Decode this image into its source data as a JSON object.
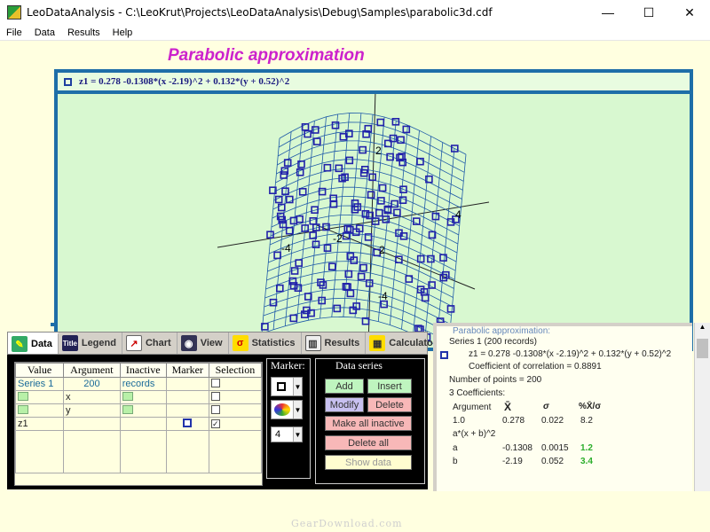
{
  "window": {
    "title": "LeoDataAnalysis - C:\\LeoKrut\\Projects\\LeoDataAnalysis\\Debug\\Samples\\parabolic3d.cdf",
    "minimize": "—",
    "maximize": "☐",
    "close": "✕"
  },
  "menu": [
    "File",
    "Data",
    "Results",
    "Help"
  ],
  "heading": "Parabolic approximation",
  "formula": "z1 = 0.278 -0.1308*(x -2.19)^2 + 0.132*(y + 0.52)^2",
  "plot_labels": {
    "neg4": "-4",
    "two_top": "2",
    "four_right": "4",
    "neg2": "-2",
    "two_mid": "2",
    "neg4_low": "-4",
    "six_low": "-6"
  },
  "tabs": [
    {
      "label": "Data",
      "icon": "pencil-icon"
    },
    {
      "label": "Legend",
      "icon": "title-icon"
    },
    {
      "label": "Chart",
      "icon": "chart-icon"
    },
    {
      "label": "View",
      "icon": "eye-icon"
    },
    {
      "label": "Statistics",
      "icon": "sigma-icon"
    },
    {
      "label": "Results",
      "icon": "book-icon"
    },
    {
      "label": "Calculator",
      "icon": "calculator-icon"
    }
  ],
  "grid": {
    "headers": [
      "Value",
      "Argument",
      "Inactive",
      "Marker",
      "Selection"
    ],
    "rows": [
      {
        "value": "Series 1",
        "argument": "200",
        "inactive": "records"
      },
      {
        "value": "",
        "argument": "x",
        "inactive": ""
      },
      {
        "value": "",
        "argument": "y",
        "inactive": ""
      },
      {
        "value": "z1",
        "argument": "",
        "inactive": ""
      }
    ]
  },
  "marker": {
    "label": "Marker:",
    "size": "4"
  },
  "series": {
    "label": "Data series",
    "add": "Add",
    "insert": "Insert",
    "modify": "Modify",
    "delete": "Delete",
    "make_inactive": "Make all inactive",
    "delete_all": "Delete all",
    "show_data": "Show data"
  },
  "results": {
    "title": "Parabolic approximation:",
    "series": "Series 1 (200 records)",
    "equation": "z1 = 0.278 -0.1308*(x -2.19)^2 + 0.132*(y + 0.52)^2",
    "correlation": "Coefficient of correlation = 0.8891",
    "points": "Number of points = 200",
    "coeffs": "3 Coefficients:",
    "col_argument": "Argument",
    "col_xbar": "X̄",
    "col_sigma": "σ",
    "col_ratio": "%X̄/σ",
    "row1": [
      "1.0",
      "0.278",
      "0.022",
      "8.2"
    ],
    "term": "a*(x + b)^2",
    "row2": [
      "a",
      "-0.1308",
      "0.0015",
      "1.2"
    ],
    "row3": [
      "b",
      "-2.19",
      "0.052",
      "3.4"
    ]
  },
  "watermark": "GearDownload.com",
  "colors": {
    "heading": "#cc22cc",
    "frame": "#1e6ea8",
    "plot_bg": "#d8f8d0",
    "marker": "#2222aa"
  }
}
